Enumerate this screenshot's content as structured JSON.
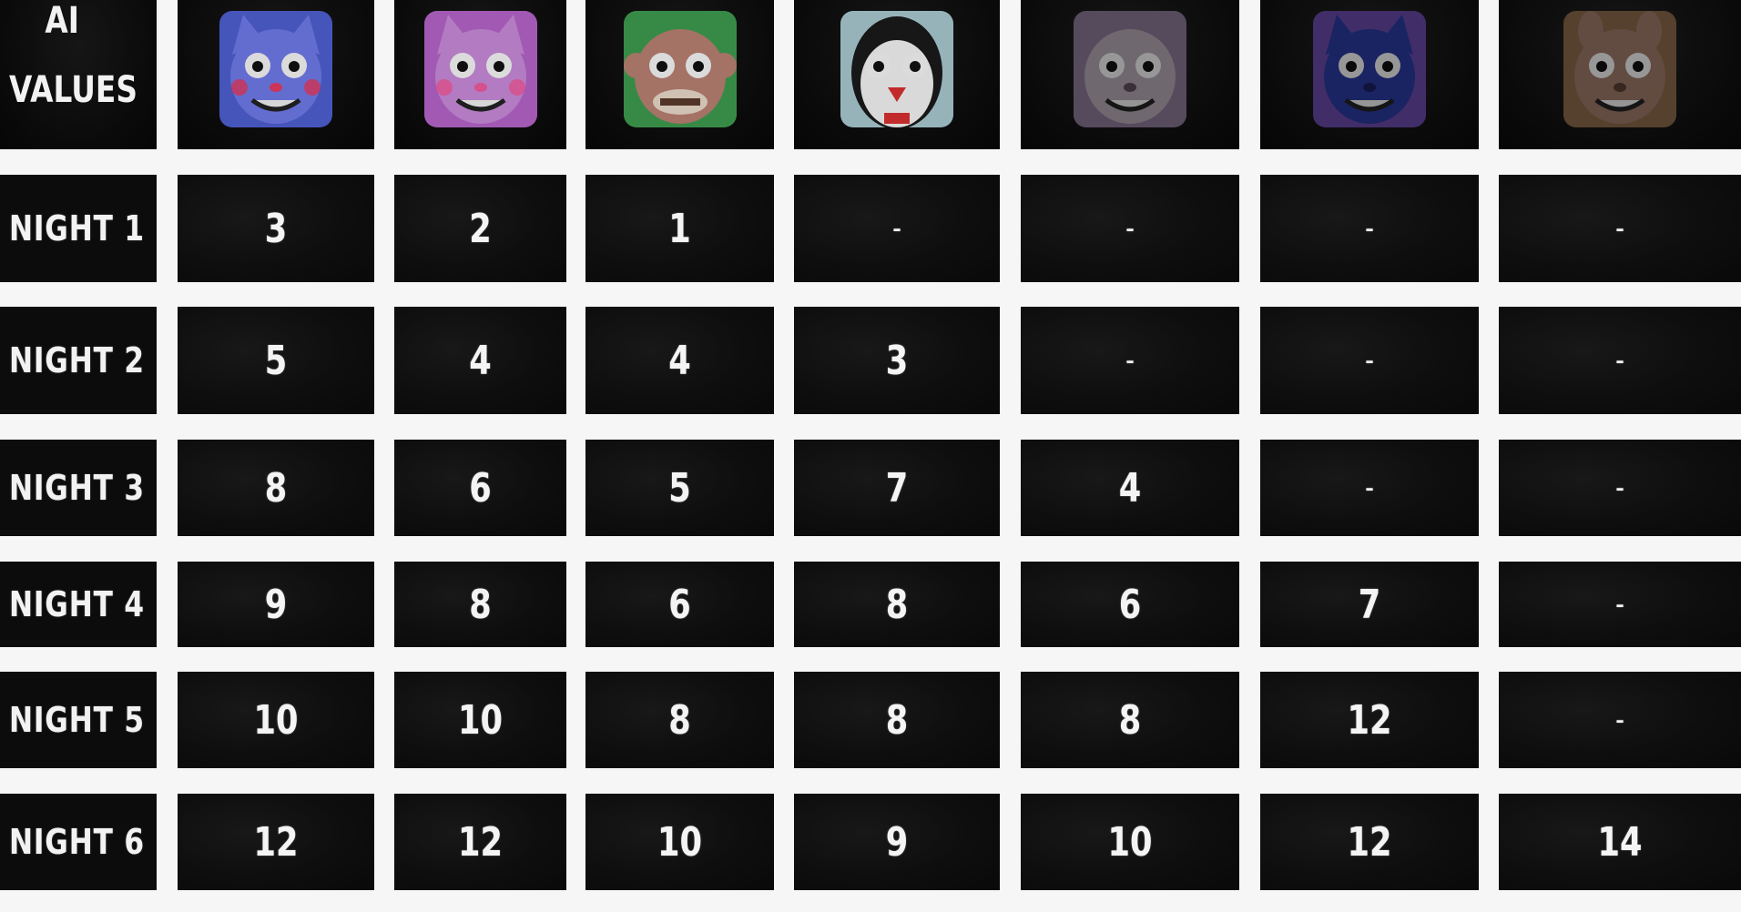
{
  "header": {
    "title_line1": "AI",
    "title_line2": "VALUES"
  },
  "characters": [
    {
      "icon": "candy-cat-icon",
      "bg": "#4f5fd0",
      "face": "#6f7ae8",
      "accent": "#e23b64"
    },
    {
      "icon": "cindy-cat-icon",
      "bg": "#b464c8",
      "face": "#c88ad8",
      "accent": "#ee5a9c"
    },
    {
      "icon": "chester-chimp-icon",
      "bg": "#3e9a4e",
      "face": "#b87f72",
      "accent": "#5a3a2a"
    },
    {
      "icon": "penguin-icon",
      "bg": "#a8c8d0",
      "face": "#f2f2f2",
      "accent": "#d83030"
    },
    {
      "icon": "rat-icon",
      "bg": "#8c7a96",
      "face": "#b4a8b4",
      "accent": "#5c4e5e"
    },
    {
      "icon": "blank-icon",
      "bg": "#6a4aa8",
      "face": "#2a3aa0",
      "accent": "#1a2060"
    },
    {
      "icon": "shadow-candy-icon",
      "bg": "#8a6a4a",
      "face": "#9e7a6a",
      "accent": "#5a3f32"
    }
  ],
  "nights": [
    {
      "label": "NIGHT 1",
      "values": [
        "3",
        "2",
        "1",
        "-",
        "-",
        "-",
        "-"
      ]
    },
    {
      "label": "NIGHT 2",
      "values": [
        "5",
        "4",
        "4",
        "3",
        "-",
        "-",
        "-"
      ]
    },
    {
      "label": "NIGHT 3",
      "values": [
        "8",
        "6",
        "5",
        "7",
        "4",
        "-",
        "-"
      ]
    },
    {
      "label": "NIGHT 4",
      "values": [
        "9",
        "8",
        "6",
        "8",
        "6",
        "7",
        "-"
      ]
    },
    {
      "label": "NIGHT 5",
      "values": [
        "10",
        "10",
        "8",
        "8",
        "8",
        "12",
        "-"
      ]
    },
    {
      "label": "NIGHT 6",
      "values": [
        "12",
        "12",
        "10",
        "9",
        "10",
        "12",
        "14"
      ]
    }
  ]
}
